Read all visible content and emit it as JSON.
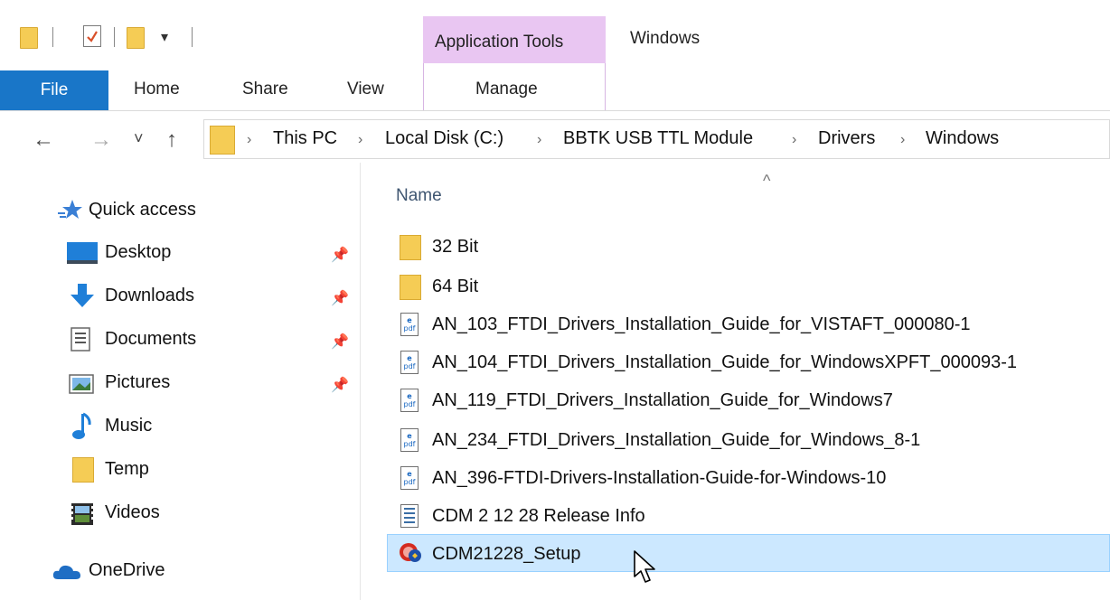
{
  "window_title": "Windows",
  "ribbon": {
    "context_group": "Application Tools",
    "context_tab": "Manage",
    "tabs": [
      "File",
      "Home",
      "Share",
      "View"
    ],
    "quick_access_dropdown": "▾"
  },
  "address": {
    "breadcrumbs": [
      "This PC",
      "Local Disk (C:)",
      "BBTK USB TTL Module",
      "Drivers",
      "Windows"
    ],
    "separator": "›"
  },
  "nav": {
    "back": "←",
    "forward": "→",
    "recent": "˅",
    "up": "↑",
    "quick_access": "Quick access",
    "items": [
      {
        "label": "Desktop",
        "icon": "desktop-icon",
        "pinned": true
      },
      {
        "label": "Downloads",
        "icon": "downloads-icon",
        "pinned": true
      },
      {
        "label": "Documents",
        "icon": "documents-icon",
        "pinned": true
      },
      {
        "label": "Pictures",
        "icon": "pictures-icon",
        "pinned": true
      },
      {
        "label": "Music",
        "icon": "music-icon",
        "pinned": false
      },
      {
        "label": "Temp",
        "icon": "folder-icon",
        "pinned": false
      },
      {
        "label": "Videos",
        "icon": "videos-icon",
        "pinned": false
      }
    ],
    "onedrive": "OneDrive",
    "pin_glyph": "📌"
  },
  "list": {
    "column_name": "Name",
    "sort_caret": "^",
    "files": [
      {
        "name": "32 Bit",
        "type": "folder"
      },
      {
        "name": "64 Bit",
        "type": "folder"
      },
      {
        "name": "AN_103_FTDI_Drivers_Installation_Guide_for_VISTAFT_000080-1",
        "type": "pdf"
      },
      {
        "name": "AN_104_FTDI_Drivers_Installation_Guide_for_WindowsXPFT_000093-1",
        "type": "pdf"
      },
      {
        "name": "AN_119_FTDI_Drivers_Installation_Guide_for_Windows7",
        "type": "pdf"
      },
      {
        "name": "AN_234_FTDI_Drivers_Installation_Guide_for_Windows_8-1",
        "type": "pdf"
      },
      {
        "name": "AN_396-FTDI-Drivers-Installation-Guide-for-Windows-10",
        "type": "pdf"
      },
      {
        "name": "CDM 2 12 28 Release Info",
        "type": "text"
      },
      {
        "name": "CDM21228_Setup",
        "type": "setup",
        "selected": true
      }
    ]
  },
  "colors": {
    "file_tab": "#1976c8",
    "context_tab": "#e9c6f2",
    "selection": "#cce8ff",
    "folder": "#f5cc55"
  }
}
